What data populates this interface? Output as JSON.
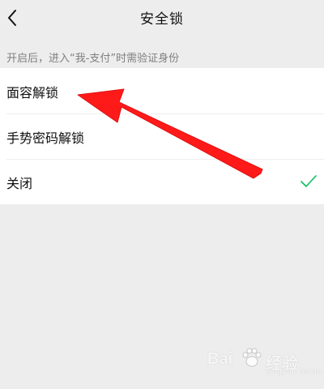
{
  "header": {
    "title": "安全锁",
    "back_icon": "chevron-left-icon"
  },
  "tip": "开启后，进入“我-支付”时需验证身份",
  "options": [
    {
      "label": "面容解锁",
      "selected": false
    },
    {
      "label": "手势密码解锁",
      "selected": false
    },
    {
      "label": "关闭",
      "selected": true
    }
  ],
  "colors": {
    "background": "#ededed",
    "check": "#07c160",
    "annotation_arrow": "#ff1a1a"
  },
  "watermark": {
    "brand": "Bai",
    "brand_suffix": "经验",
    "url": "jingyan.baidu.com"
  }
}
